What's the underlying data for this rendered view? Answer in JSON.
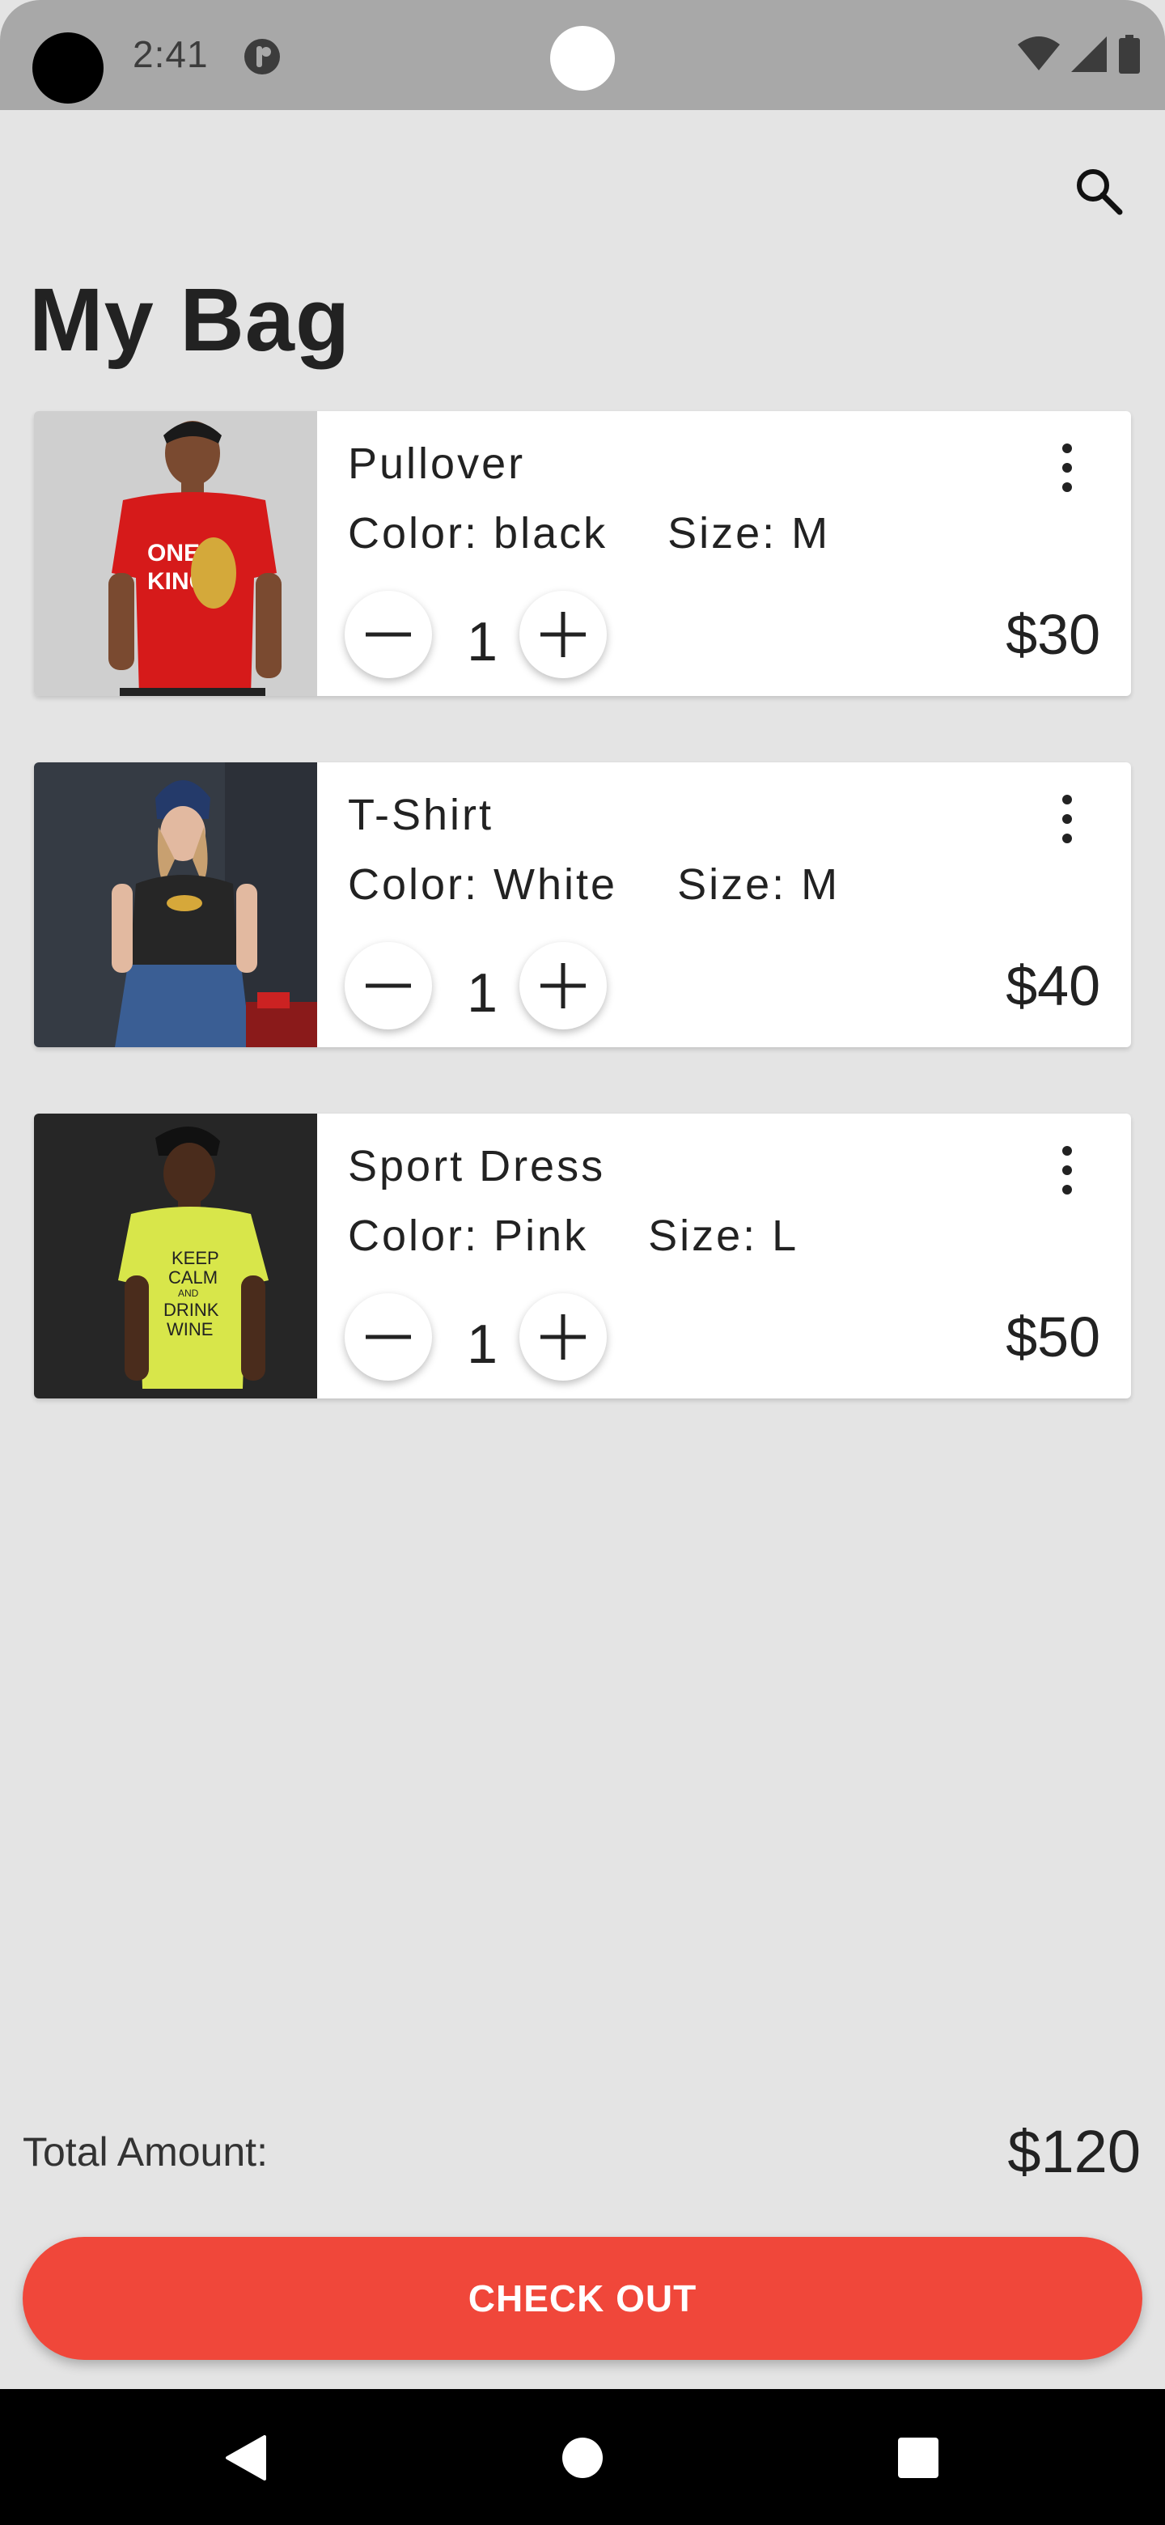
{
  "status_bar": {
    "time": "2:41",
    "icons": [
      "app-notification-icon",
      "wifi-icon",
      "signal-icon",
      "battery-icon"
    ]
  },
  "header": {
    "search_icon": "search-icon",
    "title": "My Bag"
  },
  "cart": {
    "items": [
      {
        "name": "Pullover",
        "color": "Color: black",
        "size": "Size: M",
        "quantity": "1",
        "price": "$30",
        "image": "man-in-red-tshirt-photo"
      },
      {
        "name": "T-Shirt",
        "color": "Color: White",
        "size": "Size: M",
        "quantity": "1",
        "price": "$40",
        "image": "woman-in-black-tshirt-photo"
      },
      {
        "name": "Sport Dress",
        "color": "Color: Pink",
        "size": "Size: L",
        "quantity": "1",
        "price": "$50",
        "image": "man-in-yellow-tshirt-photo"
      }
    ]
  },
  "summary": {
    "total_label": "Total Amount:",
    "total_value": "$120",
    "checkout_label": "CHECK OUT"
  },
  "colors": {
    "background": "#e4e4e4",
    "accent": "#f0473a",
    "status_bar": "#a8a8a8"
  }
}
